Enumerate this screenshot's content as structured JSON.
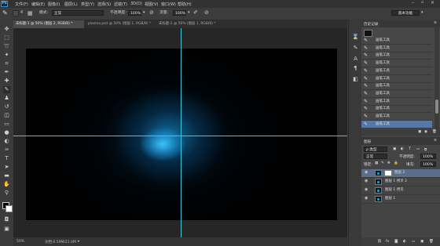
{
  "app": {
    "logo": "Ps",
    "accent": "#3fc7d9",
    "selection_color": "#5778a5"
  },
  "menubar": {
    "items": [
      "文件(F)",
      "编辑(E)",
      "图像(I)",
      "图层(L)",
      "类型(Y)",
      "选择(S)",
      "滤镜(T)",
      "3D(D)",
      "视图(V)",
      "窗口(W)",
      "帮助(H)"
    ]
  },
  "options": {
    "brush_size": "4",
    "mode_label": "模式:",
    "mode_value": "正常",
    "opacity_label": "不透明度:",
    "opacity_value": "100%",
    "flow_label": "流量:",
    "flow_value": "100%",
    "workspace_button": "基本功能"
  },
  "tabs": [
    {
      "label": "未标题-1 @ 50% (图层 2, RGB/8) *",
      "active": true
    },
    {
      "label": "plasma.psd @ 50% (图层 1, RGB/8) *",
      "active": false
    },
    {
      "label": "未标题-2 @ 50% (图层 1, RGB/8) *",
      "active": false
    }
  ],
  "status": {
    "zoom": "50%",
    "doc": "文档:6.59M/21.0M"
  },
  "history": {
    "tab": "历史记录",
    "items": [
      "画笔工具",
      "画笔工具",
      "画笔工具",
      "画笔工具",
      "画笔工具",
      "画笔工具",
      "画笔工具",
      "画笔工具",
      "画笔工具",
      "画笔工具",
      "画笔工具",
      "画笔工具"
    ],
    "selected_index": 11
  },
  "layers": {
    "tab": "图层",
    "kind": "ρ 类型",
    "blend": "正常",
    "opacity_label": "不透明度:",
    "opacity_value": "100%",
    "lock_label": "锁定:",
    "fill_label": "填充:",
    "fill_value": "100%",
    "items": [
      {
        "name": "图层 2",
        "selected": true
      },
      {
        "name": "图层 1 拷贝 2",
        "selected": false
      },
      {
        "name": "图层 1 拷贝",
        "selected": false
      },
      {
        "name": "图层 1",
        "selected": false
      }
    ]
  }
}
